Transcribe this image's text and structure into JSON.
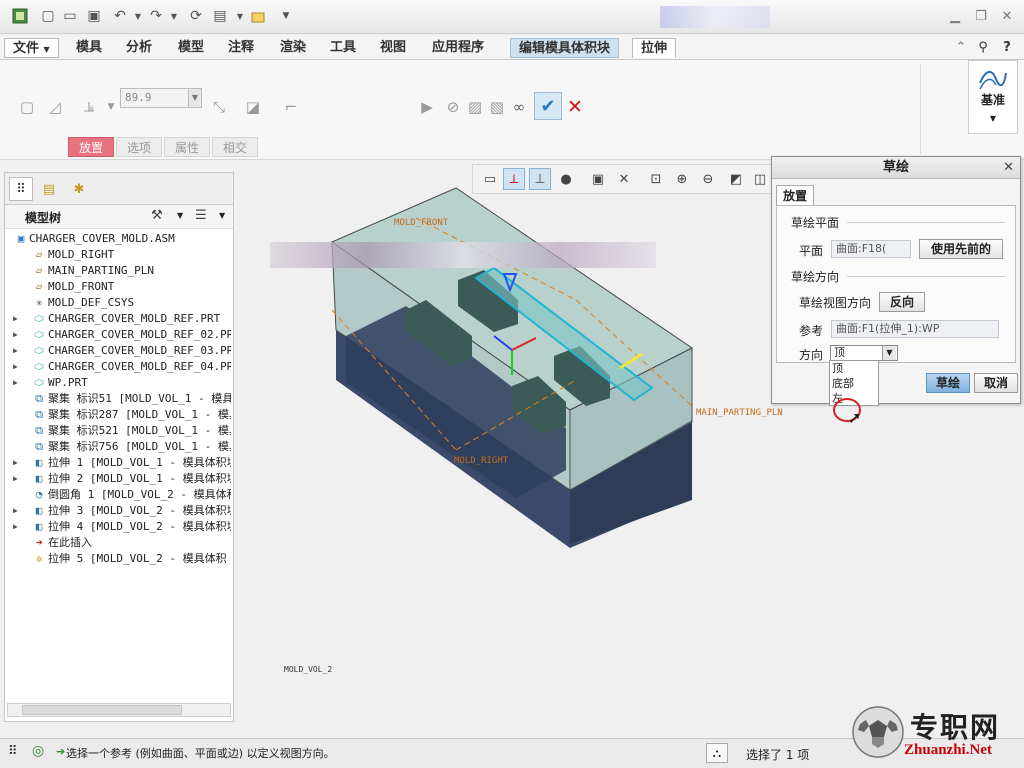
{
  "menu": {
    "tabs": [
      "文件",
      "模具",
      "分析",
      "模型",
      "注释",
      "渲染",
      "工具",
      "视图",
      "应用程序",
      "编辑模具体积块",
      "拉伸"
    ]
  },
  "ribbon": {
    "depth_value": "89.9",
    "sub_tabs": [
      "放置",
      "选项",
      "属性",
      "相交"
    ],
    "datum_label": "基准"
  },
  "model_tree": {
    "title": "模型树",
    "items": [
      {
        "label": "CHARGER_COVER_MOLD.ASM",
        "icon": "assembly-icon",
        "expand": ""
      },
      {
        "label": "MOLD_RIGHT",
        "icon": "datum-plane-icon",
        "expand": ""
      },
      {
        "label": "MAIN_PARTING_PLN",
        "icon": "datum-plane-icon",
        "expand": ""
      },
      {
        "label": "MOLD_FRONT",
        "icon": "datum-plane-icon",
        "expand": ""
      },
      {
        "label": "MOLD_DEF_CSYS",
        "icon": "csys-icon",
        "expand": ""
      },
      {
        "label": "CHARGER_COVER_MOLD_REF.PRT",
        "icon": "part-icon",
        "expand": "▶"
      },
      {
        "label": "CHARGER_COVER_MOLD_REF_02.PRT",
        "icon": "part-icon",
        "expand": "▶"
      },
      {
        "label": "CHARGER_COVER_MOLD_REF_03.PRT",
        "icon": "part-icon",
        "expand": "▶"
      },
      {
        "label": "CHARGER_COVER_MOLD_REF_04.PRT",
        "icon": "part-icon",
        "expand": "▶"
      },
      {
        "label": "WP.PRT",
        "icon": "part-icon",
        "expand": "▶"
      },
      {
        "label": "聚集 标识51 [MOLD_VOL_1 - 模具体",
        "icon": "feature-icon",
        "expand": ""
      },
      {
        "label": "聚集 标识287 [MOLD_VOL_1 - 模具",
        "icon": "feature-icon",
        "expand": ""
      },
      {
        "label": "聚集 标识521 [MOLD_VOL_1 - 模具",
        "icon": "feature-icon",
        "expand": ""
      },
      {
        "label": "聚集 标识756 [MOLD_VOL_1 - 模具",
        "icon": "feature-icon",
        "expand": ""
      },
      {
        "label": "拉伸 1 [MOLD_VOL_1 - 模具体积块",
        "icon": "extrude-icon",
        "expand": "▶"
      },
      {
        "label": "拉伸 2 [MOLD_VOL_1 - 模具体积块",
        "icon": "extrude-icon",
        "expand": "▶"
      },
      {
        "label": "倒圆角 1 [MOLD_VOL_2 - 模具体积",
        "icon": "round-icon",
        "expand": ""
      },
      {
        "label": "拉伸 3 [MOLD_VOL_2 - 模具体积块",
        "icon": "extrude-icon",
        "expand": "▶"
      },
      {
        "label": "拉伸 4 [MOLD_VOL_2 - 模具体积块",
        "icon": "extrude-icon",
        "expand": "▶"
      },
      {
        "label": "在此插入",
        "icon": "insert-arrow-icon",
        "expand": ""
      },
      {
        "label": "拉伸 5 [MOLD_VOL_2 - 模具体积",
        "icon": "extrude-new-icon",
        "expand": ""
      }
    ]
  },
  "graphics": {
    "labels": {
      "mold_front": "MOLD_FRONT",
      "main_parting": "MAIN_PARTING_PLN",
      "mold_right": "MOLD_RIGHT"
    },
    "footer": "MOLD_VOL_2"
  },
  "sketch_dialog": {
    "title": "草绘",
    "tab": "放置",
    "plane_section": "草绘平面",
    "plane_label": "平面",
    "plane_value": "曲面:F18(",
    "use_prev_button": "使用先前的",
    "direction_section": "草绘方向",
    "view_dir_label": "草绘视图方向",
    "flip_button": "反向",
    "ref_label": "参考",
    "ref_value": "曲面:F1(拉伸_1):WP",
    "dir_label": "方向",
    "dir_selected": "顶",
    "dir_options": [
      "顶",
      "底部",
      "左"
    ],
    "ok_button": "草绘",
    "cancel_button": "取消"
  },
  "status": {
    "message": "选择一个参考 (例如曲面、平面或边) 以定义视图方向。",
    "selection": "选择了 1 项"
  },
  "watermark": {
    "cn": "专职网",
    "en": "Zhuanzhi.Net"
  }
}
